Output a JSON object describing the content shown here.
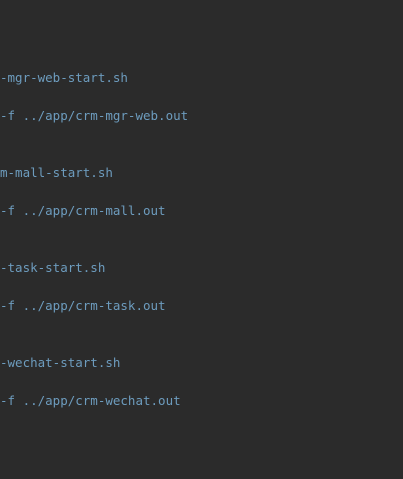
{
  "editor": {
    "lines": [
      "-mgr-web-start.sh",
      "-f ../app/crm-mgr-web.out",
      "m-mall-start.sh",
      "-f ../app/crm-mall.out",
      "-task-start.sh",
      "-f ../app/crm-task.out",
      "-wechat-start.sh",
      "-f ../app/crm-wechat.out"
    ],
    "text_color": "#6d9cbe",
    "background": "#2b2b2b"
  }
}
